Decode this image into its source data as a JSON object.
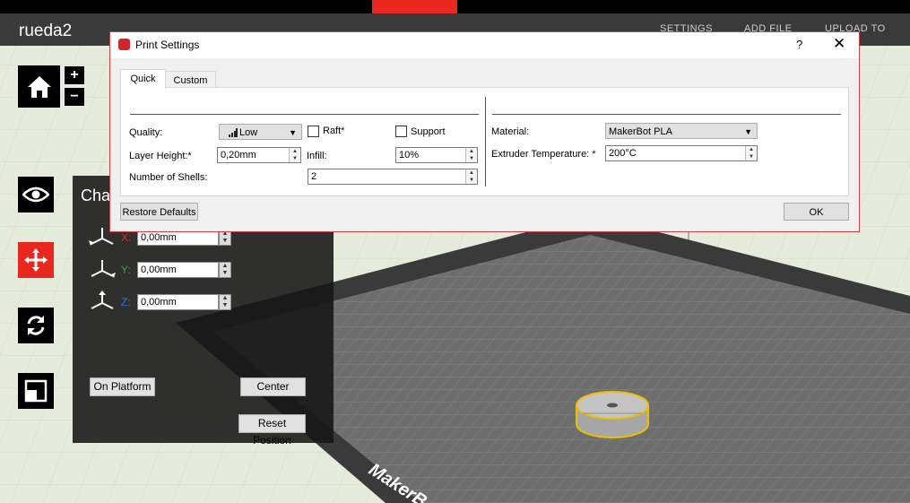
{
  "app": {
    "file_title": "rueda2",
    "nav": {
      "settings": "SETTINGS",
      "add_file": "ADD FILE",
      "upload": "UPLOAD TO LIBRA"
    }
  },
  "colors": {
    "accent": "#e8281e",
    "toolbar_bg": "#000000",
    "header_bg": "#3a3a3a",
    "model_outline": "#f0c000"
  },
  "toolbar": {
    "zoom_in": "+",
    "zoom_out": "−",
    "home_icon": "home-icon",
    "view_icon": "eye-icon",
    "move_icon": "move-arrows-icon",
    "rotate_icon": "rotate-icon",
    "scale_icon": "scale-icon"
  },
  "move_panel": {
    "title": "Cha",
    "x_label": "X:",
    "x_value": "0,00mm",
    "x_color": "#d03030",
    "y_label": "Y:",
    "y_value": "0,00mm",
    "y_color": "#30b030",
    "z_label": "Z:",
    "z_value": "0,00mm",
    "z_color": "#3070e0",
    "on_platform": "On Platform",
    "center": "Center",
    "reset_position": "Reset Position"
  },
  "platform_label": "MakerB",
  "dialog": {
    "title": "Print Settings",
    "help": "?",
    "close": "✕",
    "tabs": [
      "Quick",
      "Custom"
    ],
    "quality_label": "Quality:",
    "quality_value": "Low",
    "layer_height_label": "Layer Height:*",
    "layer_height_value": "0,20mm",
    "shells_label": "Number of Shells:",
    "shells_value": "2",
    "raft_label": "Raft*",
    "support_label": "Support",
    "infill_label": "Infill:",
    "infill_value": "10%",
    "material_label": "Material:",
    "material_value": "MakerBot PLA",
    "extruder_temp_label": "Extruder Temperature: *",
    "extruder_temp_value": "200°C",
    "restore_defaults": "Restore Defaults",
    "ok": "OK"
  }
}
